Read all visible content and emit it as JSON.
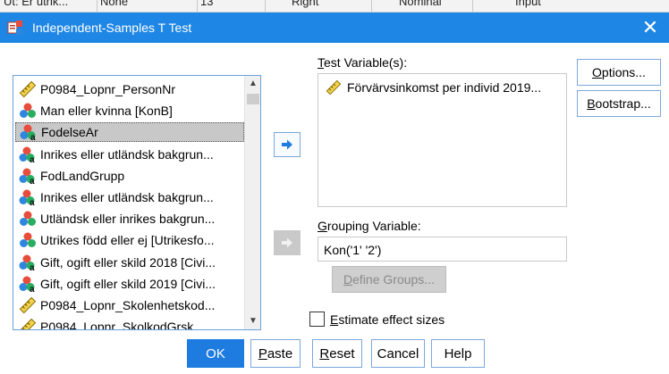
{
  "background": {
    "cells": [
      "Ut: Er utrik...",
      "None",
      "13",
      "Right",
      "Nominal",
      "Input"
    ]
  },
  "window": {
    "title": "Independent-Samples T Test",
    "close_glyph": "✕"
  },
  "source_list": {
    "items": [
      {
        "label": "P0984_Lopnr_PersonNr",
        "icon": "ruler-scale-icon",
        "selected": false
      },
      {
        "label": "Man eller kvinna [KonB]",
        "icon": "nominal-circles-icon",
        "selected": false
      },
      {
        "label": "FodelseAr",
        "icon": "nominal-string-icon",
        "selected": true
      },
      {
        "label": "Inrikes eller utländsk bakgrun...",
        "icon": "nominal-string-icon",
        "selected": false
      },
      {
        "label": "FodLandGrupp",
        "icon": "nominal-string-icon",
        "selected": false
      },
      {
        "label": "Inrikes eller utländsk bakgrun...",
        "icon": "nominal-string-icon",
        "selected": false
      },
      {
        "label": "Utländsk eller inrikes bakgrun...",
        "icon": "nominal-circles-icon",
        "selected": false
      },
      {
        "label": "Utrikes född eller ej [Utrikesfo...",
        "icon": "nominal-circles-icon",
        "selected": false
      },
      {
        "label": "Gift, ogift eller skild 2018 [Civi...",
        "icon": "nominal-string-icon",
        "selected": false
      },
      {
        "label": "Gift, ogift eller skild 2019 [Civi...",
        "icon": "nominal-string-icon",
        "selected": false
      },
      {
        "label": "P0984_Lopnr_Skolenhetskod...",
        "icon": "ruler-scale-icon",
        "selected": false
      },
      {
        "label": "P0984_Lopnr_SkolkodGrsk...",
        "icon": "ruler-scale-icon",
        "selected": false
      }
    ]
  },
  "test_variables": {
    "label_accel": "T",
    "label_rest": "est Variable(s):",
    "items": [
      {
        "label": "Förvärvsinkomst per individ 2019...",
        "icon": "ruler-scale-icon"
      }
    ]
  },
  "grouping": {
    "label_accel": "G",
    "label_rest": "rouping Variable:",
    "value": "Kon('1' '2')",
    "define_accel": "D",
    "define_rest": "efine Groups..."
  },
  "options": {
    "options_accel": "O",
    "options_rest": "ptions...",
    "bootstrap_accel": "B",
    "bootstrap_rest": "ootstrap..."
  },
  "effect_sizes": {
    "accel": "E",
    "rest": "stimate effect sizes",
    "checked": false
  },
  "buttons": {
    "ok": "OK",
    "paste_accel": "P",
    "paste_rest": "aste",
    "reset_accel": "R",
    "reset_rest": "eset",
    "cancel": "Cancel",
    "help": "Help"
  },
  "colors": {
    "titlebar": "#1e86e4",
    "primary_button": "#1e7be0",
    "selection": "#c8c8c8"
  }
}
